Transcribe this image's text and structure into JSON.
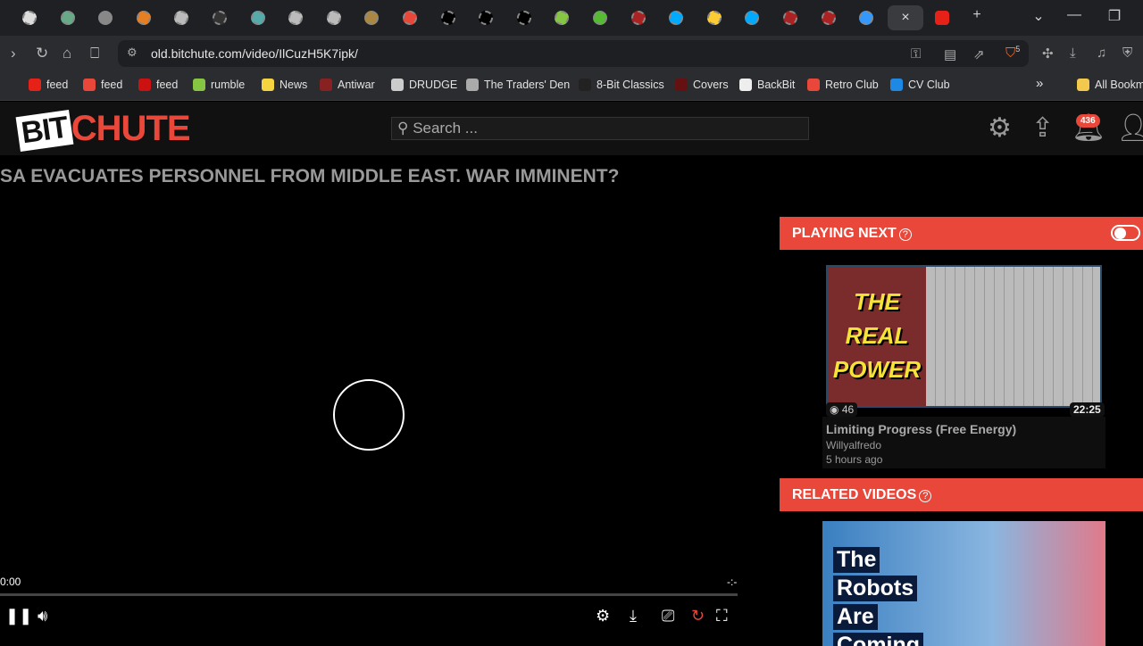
{
  "browser": {
    "tab_count_favicons": 22,
    "active_tab_close": "×",
    "new_tab": "+",
    "url": "old.bitchute.com/video/IlCuzH5K7ipk/",
    "brave_badge": "5",
    "bookmarks": [
      {
        "label": "feed",
        "color": "#e62117"
      },
      {
        "label": "feed",
        "color": "#e8473a"
      },
      {
        "label": "feed",
        "color": "#cc1111"
      },
      {
        "label": "rumble",
        "color": "#85c742"
      },
      {
        "label": "News",
        "color": "#f5d442"
      },
      {
        "label": "Antiwar",
        "color": "#882222"
      },
      {
        "label": "DRUDGE",
        "color": "#cccccc"
      },
      {
        "label": "The Traders' Den",
        "color": "#aaaaaa"
      },
      {
        "label": "8-Bit Classics",
        "color": "#222222"
      },
      {
        "label": "Covers",
        "color": "#661111"
      },
      {
        "label": "BackBit",
        "color": "#eeeeee"
      },
      {
        "label": "Retro Club",
        "color": "#e8473a"
      },
      {
        "label": "CV Club",
        "color": "#1e88e5"
      }
    ],
    "more_bookmarks": "»",
    "all_bookmarks": "All Bookmarks"
  },
  "site": {
    "logo_bit": "BIT",
    "logo_chute": "CHUTE",
    "search_placeholder": "Search ...",
    "notification_count": "436",
    "accent": "#e8473a"
  },
  "video": {
    "title": "SA EVACUATES PERSONNEL FROM MIDDLE EAST. WAR IMMINENT?",
    "current_time": "0:00",
    "duration": "-:-",
    "progress": 0
  },
  "playing_next": {
    "header": "PLAYING NEXT",
    "autoplay": false,
    "thumb_text": "THE REAL POWER",
    "views": "46",
    "duration": "22:25",
    "title": "Limiting Progress (Free Energy)",
    "channel": "Willyalfredo",
    "age": "5 hours ago"
  },
  "related": {
    "header": "RELATED VIDEOS",
    "thumb_lines": [
      "The",
      "Robots",
      "Are",
      "Coming"
    ]
  }
}
